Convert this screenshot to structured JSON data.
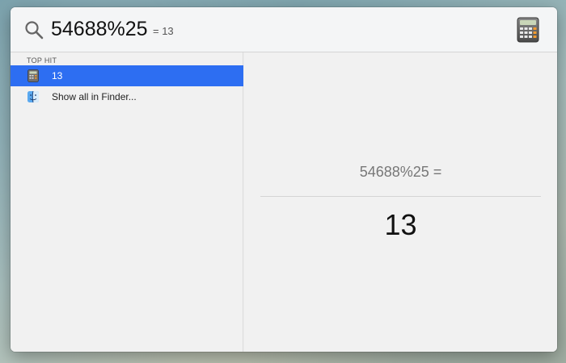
{
  "search": {
    "query": "54688%25",
    "inline_result": "= 13",
    "icon": "search-icon"
  },
  "app_icon": "calculator-icon",
  "results": {
    "section_header": "TOP HIT",
    "items": [
      {
        "label": "13",
        "icon": "calculator-icon",
        "selected": true
      },
      {
        "label": "Show all in Finder...",
        "icon": "finder-icon",
        "selected": false
      }
    ]
  },
  "preview": {
    "expression": "54688%25 =",
    "answer": "13"
  },
  "colors": {
    "selection": "#2d6ef2"
  }
}
